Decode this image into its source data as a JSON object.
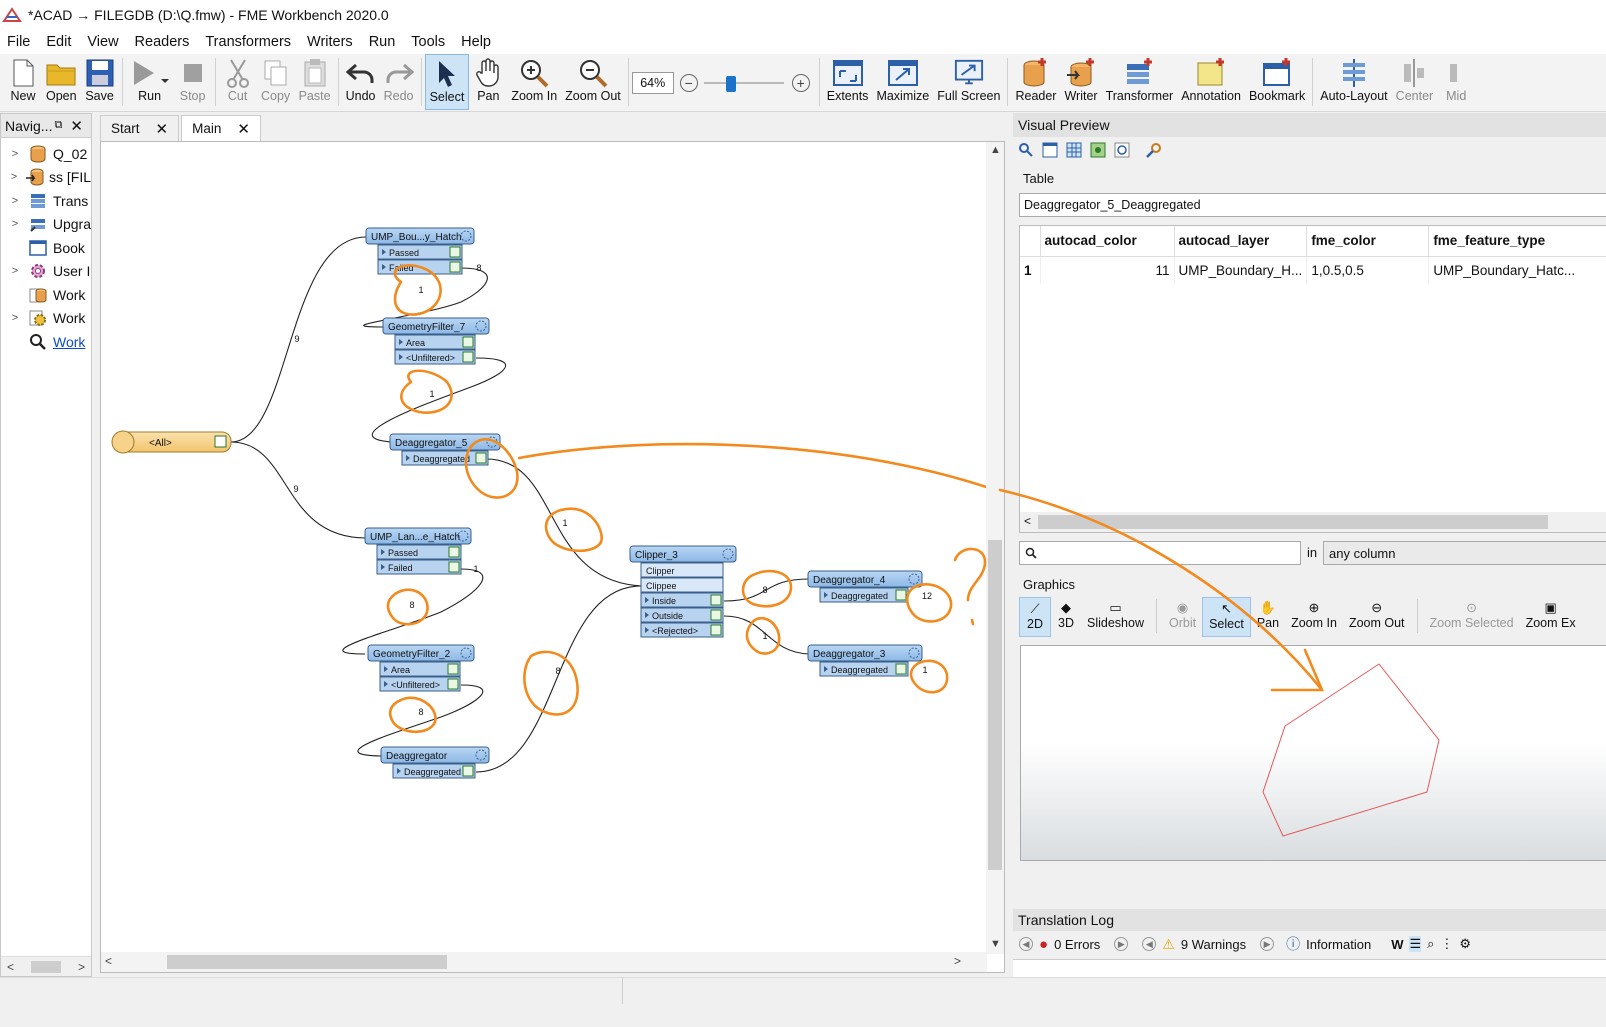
{
  "window": {
    "title": "*ACAD → FILEGDB (D:\\Q.fmw) - FME Workbench 2020.0"
  },
  "menu": [
    "File",
    "Edit",
    "View",
    "Readers",
    "Transformers",
    "Writers",
    "Run",
    "Tools",
    "Help"
  ],
  "toolbar": {
    "new": "New",
    "open": "Open",
    "save": "Save",
    "run": "Run",
    "stop": "Stop",
    "cut": "Cut",
    "copy": "Copy",
    "paste": "Paste",
    "undo": "Undo",
    "redo": "Redo",
    "select": "Select",
    "pan": "Pan",
    "zoom_in": "Zoom In",
    "zoom_out": "Zoom Out",
    "zoom_value": "64%",
    "extents": "Extents",
    "maximize": "Maximize",
    "full_screen": "Full Screen",
    "reader": "Reader",
    "writer": "Writer",
    "transformer": "Transformer",
    "annotation": "Annotation",
    "bookmark": "Bookmark",
    "auto_layout": "Auto-Layout",
    "center": "Center",
    "mid": "Mid"
  },
  "navigator": {
    "title": "Navig...",
    "items": [
      {
        "label": "Q_02",
        "icon": "reader-db-icon"
      },
      {
        "label": "ss [FIL",
        "icon": "writer-db-icon"
      },
      {
        "label": "Trans",
        "icon": "transformers-icon"
      },
      {
        "label": "Upgra",
        "icon": "upgrade-icon"
      },
      {
        "label": "Book",
        "icon": "bookmark-icon"
      },
      {
        "label": "User I",
        "icon": "user-params-icon"
      },
      {
        "label": "Work",
        "icon": "workspace-icon"
      },
      {
        "label": "Work",
        "icon": "workspace-settings-icon"
      },
      {
        "label": "Work",
        "icon": "search-icon"
      }
    ]
  },
  "tabs": [
    "Start",
    "Main"
  ],
  "canvas": {
    "source": {
      "label": "<All>"
    },
    "nodes": {
      "t1": {
        "title": "UMP_Bou...y_Hatch",
        "ports": [
          "Passed",
          "Failed"
        ]
      },
      "gf7": {
        "title": "GeometryFilter_7",
        "ports": [
          "Area",
          "<Unfiltered>"
        ]
      },
      "d5": {
        "title": "Deaggregator_5",
        "ports": [
          "Deaggregated"
        ]
      },
      "t2": {
        "title": "UMP_Lan...e_Hatch",
        "ports": [
          "Passed",
          "Failed"
        ]
      },
      "gf2": {
        "title": "GeometryFilter_2",
        "ports": [
          "Area",
          "<Unfiltered>"
        ]
      },
      "d0": {
        "title": "Deaggregator",
        "ports": [
          "Deaggregated"
        ]
      },
      "clip": {
        "title": "Clipper_3",
        "inputs": [
          "Clipper",
          "Clippee"
        ],
        "ports": [
          "Inside",
          "Outside",
          "<Rejected>"
        ]
      },
      "d4": {
        "title": "Deaggregator_4",
        "ports": [
          "Deaggregated"
        ]
      },
      "d3": {
        "title": "Deaggregator_3",
        "ports": [
          "Deaggregated"
        ]
      }
    },
    "counts": {
      "src_t1": "9",
      "src_t2": "9",
      "t1_failed": "8",
      "t1_gf7": "1",
      "gf7_d5": "1",
      "d5_clip": "1",
      "t2_failed": "1",
      "t2_gf2": "8",
      "gf2_d0": "8",
      "d0_clip": "8",
      "clip_d4": "8",
      "clip_d3": "1",
      "d4_out": "12",
      "d3_out": "1"
    },
    "annotation_mark": "?"
  },
  "visual_preview": {
    "title": "Visual Preview",
    "table_label": "Table",
    "table_name": "Deaggregator_5_Deaggregated",
    "columns": [
      "autocad_color",
      "autocad_layer",
      "fme_color",
      "fme_feature_type"
    ],
    "rows": [
      [
        "1",
        "11",
        "UMP_Boundary_H...",
        "1,0.5,0.5",
        "UMP_Boundary_Hatc..."
      ]
    ],
    "search_placeholder": "",
    "in_label": "in",
    "column_filter": "any column",
    "graphics_label": "Graphics",
    "graphics_toolbar": [
      "2D",
      "3D",
      "Slideshow",
      "Orbit",
      "Select",
      "Pan",
      "Zoom In",
      "Zoom Out",
      "Zoom Selected",
      "Zoom Ex"
    ]
  },
  "translation_log": {
    "title": "Translation Log",
    "errors": "0 Errors",
    "warnings": "9 Warnings",
    "information": "Information"
  },
  "colors": {
    "accent": "#1a73c8",
    "node_fill": "#9cc3ea",
    "source_fill": "#f7d28a",
    "annotation": "#f28a1e"
  }
}
